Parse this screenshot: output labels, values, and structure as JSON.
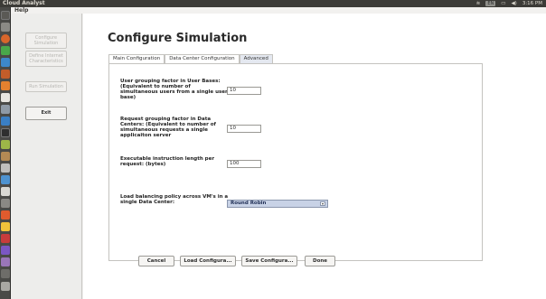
{
  "app": {
    "title": "Cloud Analyst"
  },
  "menu": {
    "help": "Help"
  },
  "tray": {
    "keyboard": "EN",
    "battery": "▭",
    "volume": "◀)",
    "time": "3:16 PM"
  },
  "sidebar": {
    "items": [
      {
        "label": "Configure Simulation",
        "state": "disabled"
      },
      {
        "label": "Define Internet Characteristics",
        "state": "disabled"
      },
      {
        "label": "Run Simulation",
        "state": "disabled"
      },
      {
        "label": "Exit",
        "state": "enabled"
      }
    ]
  },
  "page": {
    "title": "Configure Simulation"
  },
  "tabs": [
    {
      "label": "Main Configuration",
      "selected": false
    },
    {
      "label": "Data Center Configuration",
      "selected": false
    },
    {
      "label": "Advanced",
      "selected": true
    }
  ],
  "advanced": {
    "user_grouping": {
      "label": "User grouping factor in User Bases: (Equivalent to number of simultaneous users from a single user base)",
      "value": "10"
    },
    "request_grouping": {
      "label": "Request grouping factor in Data Centers: (Equivalent to number of simultaneous requests a single applicaiton server",
      "value": "10"
    },
    "instruction_length": {
      "label": "Executable instruction length per request: (bytes)",
      "value": "100"
    },
    "load_balancing": {
      "label": "Load balancing policy across VM's in a single Data Center:",
      "value": "Round Robin"
    }
  },
  "buttons": {
    "cancel": "Cancel",
    "load": "Load Configura...",
    "save": "Save Configura...",
    "done": "Done"
  },
  "colors": {
    "accent": "#c8d2e6",
    "launcher": "#4a4a47",
    "topbar": "#3c3b37"
  }
}
